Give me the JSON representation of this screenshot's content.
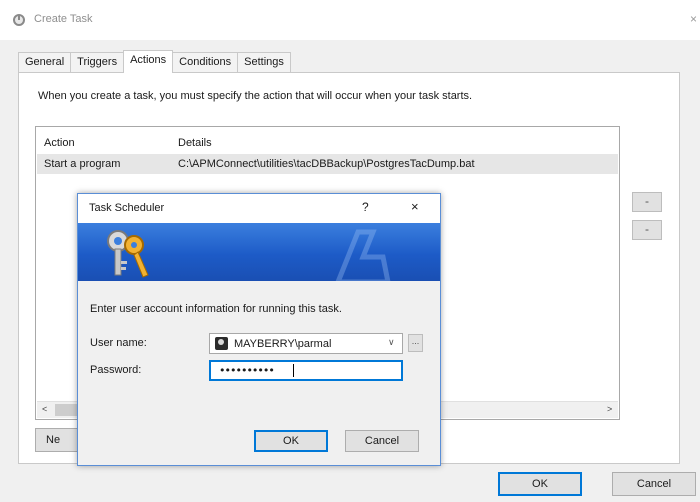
{
  "window": {
    "title": "Create Task",
    "close_glyph": "×"
  },
  "tabs": [
    {
      "label": "General",
      "active": false
    },
    {
      "label": "Triggers",
      "active": false
    },
    {
      "label": "Actions",
      "active": true
    },
    {
      "label": "Conditions",
      "active": false
    },
    {
      "label": "Settings",
      "active": false
    }
  ],
  "actions_tab": {
    "intro": "When you create a task, you must specify the action that will occur when your task starts.",
    "columns": [
      "Action",
      "Details"
    ],
    "rows": [
      {
        "action": "Start a program",
        "details": "C:\\APMConnect\\utilities\\tacDBBackup\\PostgresTacDump.bat"
      }
    ],
    "side_buttons": [
      "-",
      "-"
    ],
    "scroll_left": "<",
    "scroll_right": ">",
    "new_button": "Ne"
  },
  "footer": {
    "ok": "OK",
    "cancel": "Cancel"
  },
  "dialog": {
    "title": "Task Scheduler",
    "help_glyph": "?",
    "close_glyph": "×",
    "prompt": "Enter user account information for running this task.",
    "user_label": "User name:",
    "user_value": "MAYBERRY\\parmal",
    "dropdown_glyph": "∨",
    "browse_glyph": "...",
    "password_label": "Password:",
    "password_value": "••••••••••",
    "ok": "OK",
    "cancel": "Cancel"
  },
  "colors": {
    "banner": "#1d5bc7",
    "focus_border": "#0078d7",
    "selected_row": "#e6e6e6"
  },
  "icons": [
    "clock-icon",
    "keys-icon",
    "user-account-icon",
    "chevron-down-icon",
    "close-icon",
    "help-icon"
  ]
}
